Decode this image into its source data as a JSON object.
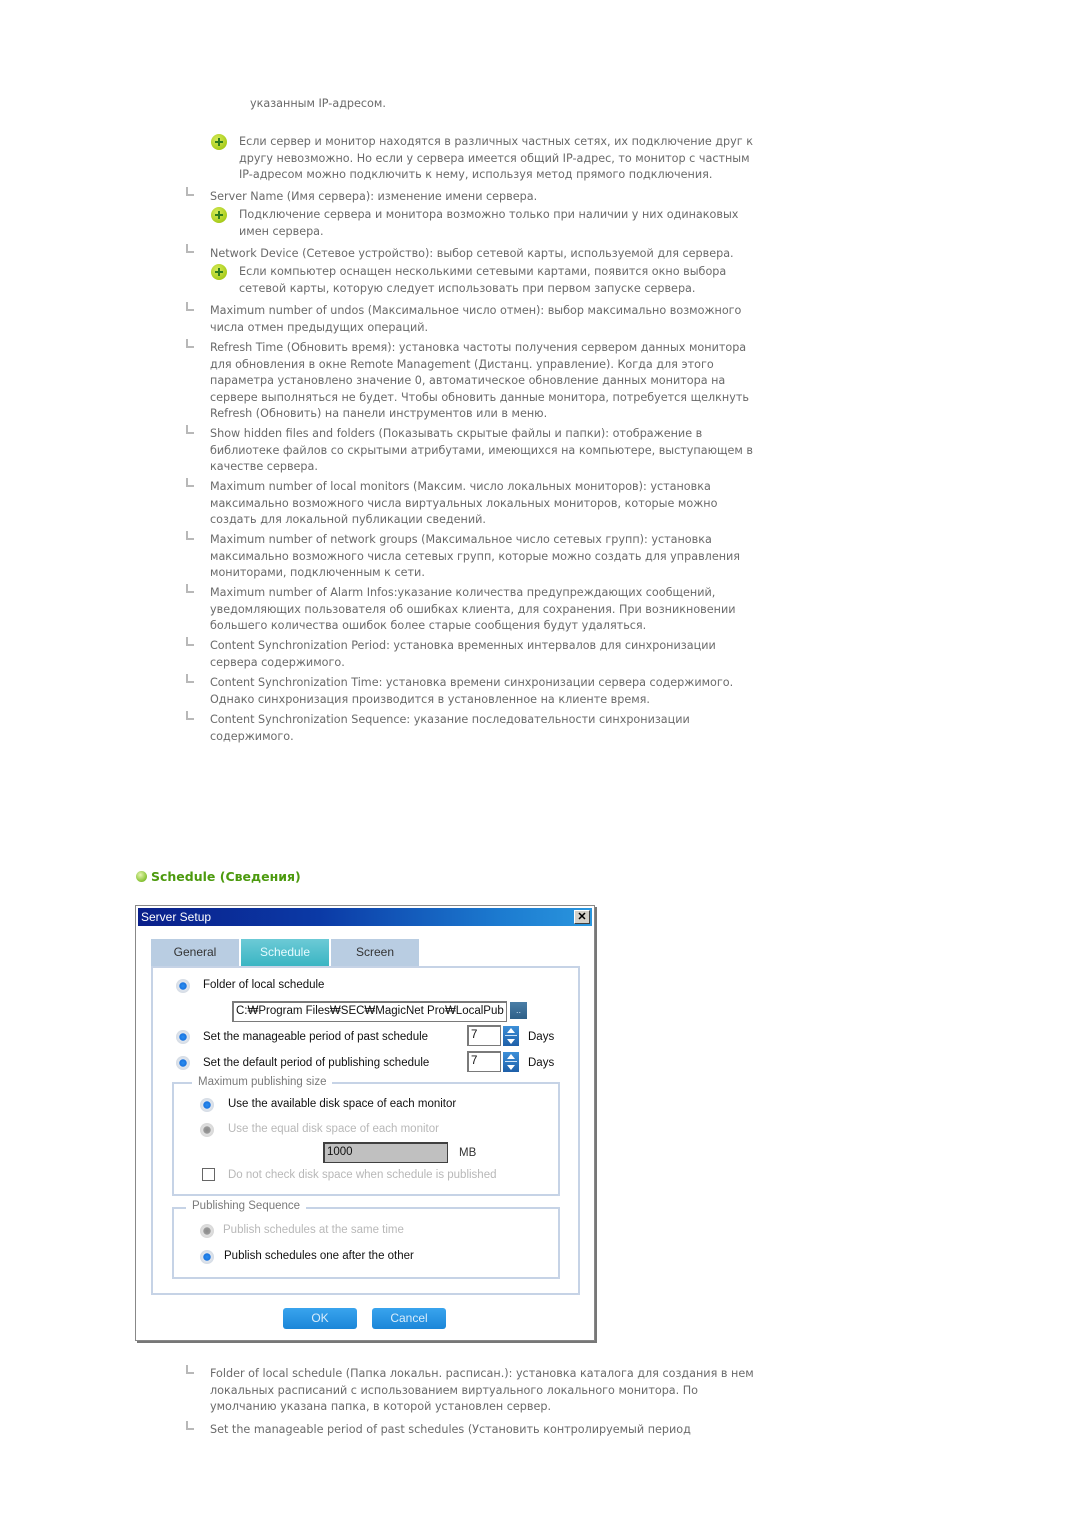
{
  "top_continuation": "указанным IP-адресом.",
  "sections_top": [
    {
      "type": "note",
      "lines": [
        "Если сервер и монитор находятся в различных частных сетях, их подключение друг к",
        "другу невозможно. Но если у сервера имеется общий IP-адрес, то монитор с частным",
        "IP-адресом можно подключить к нему, используя метод прямого подключения."
      ]
    },
    {
      "type": "bullet",
      "lines": [
        "Server Name (Имя сервера): изменение имени сервера."
      ]
    },
    {
      "type": "note",
      "lines": [
        "Подключение сервера и монитора возможно только при наличии у них одинаковых",
        "имен сервера."
      ]
    },
    {
      "type": "bullet",
      "lines": [
        "Network Device (Сетевое устройство): выбор сетевой карты, используемой для сервера."
      ]
    },
    {
      "type": "note",
      "lines": [
        "Если компьютер оснащен несколькими сетевыми картами, появится окно выбора",
        "сетевой карты, которую следует использовать при первом запуске сервера."
      ]
    },
    {
      "type": "bullet",
      "lines": [
        "Maximum number of undos (Максимальное число отмен): выбор максимально возможного",
        "числа отмен предыдущих операций."
      ]
    },
    {
      "type": "bullet",
      "lines": [
        "Refresh Time (Обновить время): установка частоты получения сервером данных монитора",
        "для обновления в окне Remote Management (Дистанц. управление). Когда для этого",
        "параметра установлено значение 0, автоматическое обновление данных монитора на",
        "сервере выполняться не будет. Чтобы обновить данные монитора, потребуется щелкнуть",
        "Refresh (Обновить) на панели инструментов или в меню."
      ]
    },
    {
      "type": "bullet",
      "lines": [
        "Show hidden files and folders (Показывать скрытые файлы и папки): отображение в",
        "библиотеке файлов со скрытыми атрибутами, имеющихся на компьютере, выступающем в",
        "качестве сервера."
      ]
    },
    {
      "type": "bullet",
      "lines": [
        "Maximum number of local monitors (Максим. число локальных мониторов): установка",
        "максимально возможного числа виртуальных локальных мониторов, которые можно",
        "создать для локальной публикации сведений."
      ]
    },
    {
      "type": "bullet",
      "lines": [
        "Maximum number of network groups (Максимальное число сетевых групп): установка",
        "максимально возможного числа сетевых групп, которые можно создать для управления",
        "мониторами, подключенным к сети."
      ]
    },
    {
      "type": "bullet",
      "lines": [
        "Maximum number of Alarm Infos:указание количества предупреждающих сообщений,",
        "уведомляющих пользователя об ошибках клиента, для сохранения. При возникновении",
        "большего количества ошибок более старые сообщения будут удаляться."
      ]
    },
    {
      "type": "bullet",
      "lines": [
        "Content Synchronization Period: установка временных интервалов для синхронизации",
        "сервера содержимого."
      ]
    },
    {
      "type": "bullet",
      "lines": [
        "Content Synchronization Time: установка времени синхронизации сервера содержимого.",
        "Однако синхронизация производится в установленное на клиенте время."
      ]
    },
    {
      "type": "bullet",
      "lines": [
        "Content Synchronization Sequence: указание последовательности синхронизации",
        "содержимого."
      ]
    }
  ],
  "section_heading": "Schedule (Сведения)",
  "dialog": {
    "title": "Server Setup",
    "close_glyph": "✕",
    "tabs": [
      {
        "label": "General",
        "active": false
      },
      {
        "label": "Schedule",
        "active": true
      },
      {
        "label": "Screen",
        "active": false
      }
    ],
    "folder_label": "Folder of local schedule",
    "folder_path": "C:₩Program Files₩SEC₩MagicNet Pro₩LocalPub",
    "browse_label": "..",
    "past_period_label": "Set the manageable period of past schedule",
    "past_period_value": "7",
    "default_period_label": "Set the default period of publishing schedule",
    "default_period_value": "7",
    "days_unit": "Days",
    "max_size_group": {
      "title": "Maximum publishing size",
      "option_available": "Use the available disk space of each monitor",
      "option_equal": "Use the equal disk space of each monitor",
      "size_value": "1000",
      "size_unit": "MB",
      "no_check_label": "Do not check disk space when schedule is published",
      "no_check_checked": false
    },
    "sequence_group": {
      "title": "Publishing Sequence",
      "option_same_time": "Publish schedules at the same time",
      "option_one_after": "Publish schedules one after the other"
    },
    "ok_label": "OK",
    "cancel_label": "Cancel"
  },
  "sections_bottom": [
    {
      "type": "bullet",
      "lines": [
        "Folder of local schedule (Папка локальн. расписан.): установка каталога для создания в нем",
        "локальных расписаний с использованием виртуального локального монитора. По",
        "умолчанию указана папка, в которой установлен сервер."
      ]
    },
    {
      "type": "bullet",
      "lines": [
        "Set the manageable period of past schedules (Установить контролируемый период"
      ]
    }
  ]
}
